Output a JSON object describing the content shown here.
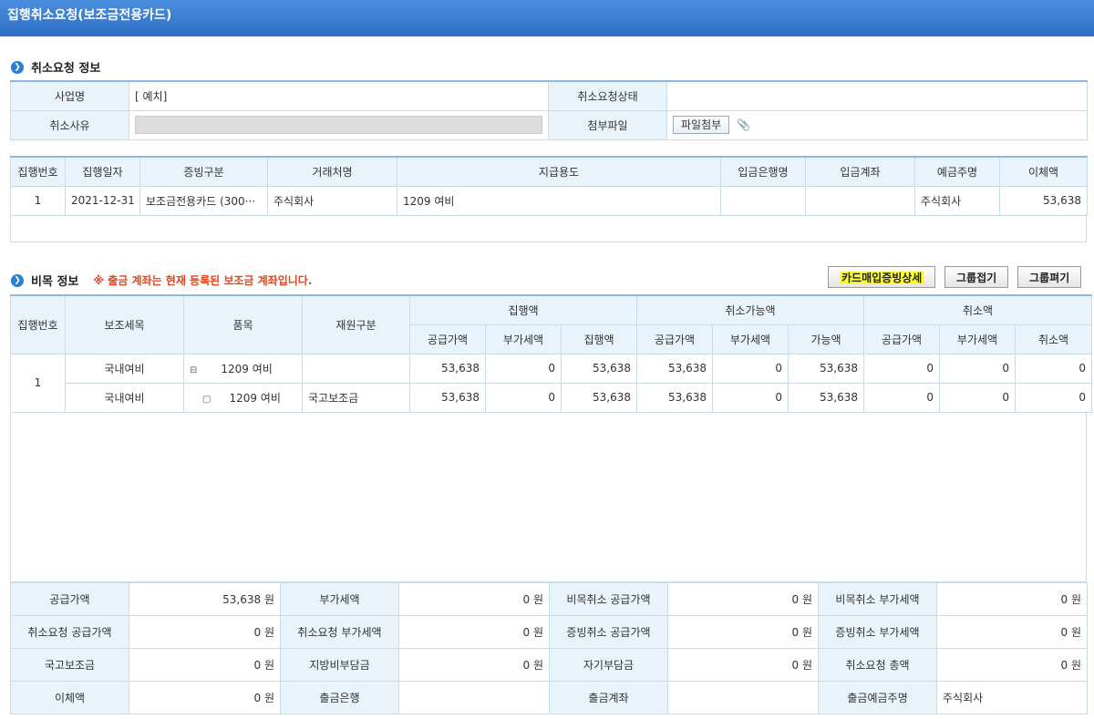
{
  "window": {
    "title": "집행취소요청(보조금전용카드)"
  },
  "section1": {
    "title": "취소요청 정보"
  },
  "info": {
    "business_label": "사업명",
    "business_value": "[   예치]",
    "status_label": "취소요청상태",
    "status_value": "",
    "reason_label": "취소사유",
    "attach_label": "첨부파일",
    "attach_button": "파일첨부"
  },
  "exec_table": {
    "headers": [
      "집행번호",
      "집행일자",
      "증빙구분",
      "거래처명",
      "지급용도",
      "입금은행명",
      "입금계좌",
      "예금주명",
      "이체액"
    ],
    "rows": [
      [
        "1",
        "2021-12-31",
        "보조금전용카드 (300···",
        "주식회사",
        "1209 여비",
        "",
        "",
        "주식회사",
        "53,638"
      ]
    ]
  },
  "section2": {
    "title": "비목 정보",
    "notice": "※ 출금 계좌는 현재 등록된 보조금 계좌입니다."
  },
  "buttons": {
    "card": "카드매입증빙상세",
    "collapse": "그룹접기",
    "expand": "그룹펴기"
  },
  "budget_table": {
    "h_no": "집행번호",
    "h_sub": "보조세목",
    "h_item": "품목",
    "h_source": "재원구분",
    "g_exec": "집행액",
    "g_avail": "취소가능액",
    "g_cancel": "취소액",
    "sub": [
      "공급가액",
      "부가세액",
      "집행액",
      "공급가액",
      "부가세액",
      "가능액",
      "공급가액",
      "부가세액",
      "취소액"
    ],
    "group_no": "1",
    "rows": [
      {
        "sub": "국내여비",
        "toggle": "⊟",
        "item": "1209 여비",
        "source": "",
        "vals": [
          "53,638",
          "0",
          "53,638",
          "53,638",
          "0",
          "53,638",
          "0",
          "0",
          "0"
        ]
      },
      {
        "sub": "국내여비",
        "toggle": "▢",
        "item": "1209 여비",
        "source": "국고보조금",
        "vals": [
          "53,638",
          "0",
          "53,638",
          "53,638",
          "0",
          "53,638",
          "0",
          "0",
          "0"
        ]
      }
    ]
  },
  "summary": [
    [
      [
        "공급가액",
        "53,638 원"
      ],
      [
        "부가세액",
        "0 원"
      ],
      [
        "비목취소 공급가액",
        "0 원"
      ],
      [
        "비목취소 부가세액",
        "0 원"
      ]
    ],
    [
      [
        "취소요청 공급가액",
        "0 원"
      ],
      [
        "취소요청 부가세액",
        "0 원"
      ],
      [
        "증빙취소 공급가액",
        "0 원"
      ],
      [
        "증빙취소 부가세액",
        "0 원"
      ]
    ],
    [
      [
        "국고보조금",
        "0 원"
      ],
      [
        "지방비부담금",
        "0 원"
      ],
      [
        "자기부담금",
        "0 원"
      ],
      [
        "취소요청 총액",
        "0 원"
      ]
    ],
    [
      [
        "이체액",
        "0 원"
      ],
      [
        "출금은행",
        ""
      ],
      [
        "출금계좌",
        ""
      ],
      [
        "출금예금주명",
        "주식회사"
      ]
    ]
  ],
  "colors": {
    "title_bar": "#2e6fc4",
    "header_bg": "#e9f3fc",
    "notice": "#e8431a",
    "highlight": "#ffff33"
  }
}
